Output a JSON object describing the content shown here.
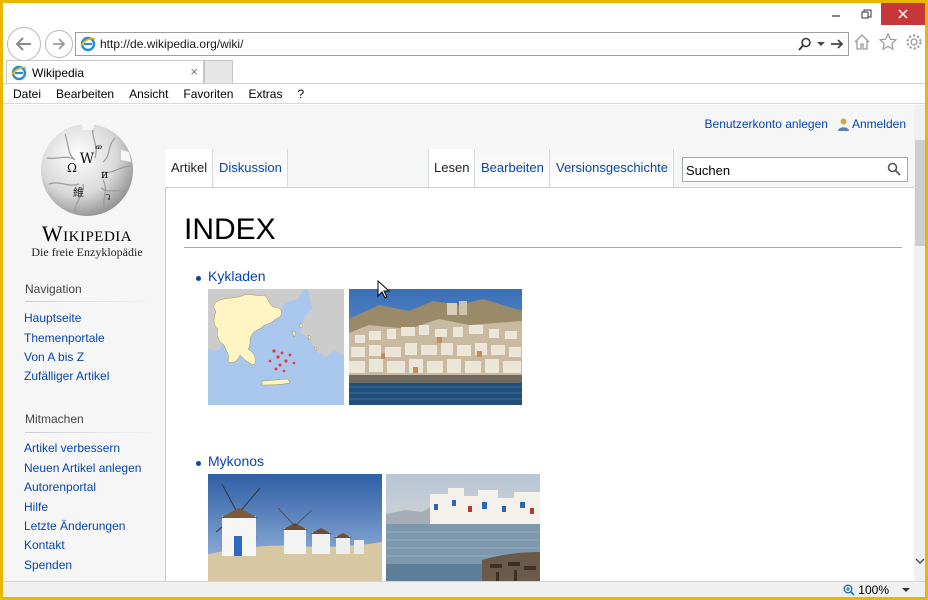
{
  "browser": {
    "url": "http://de.wikipedia.org/wiki/",
    "tab_title": "Wikipedia",
    "tab_close": "×",
    "zoom": "100%"
  },
  "menu": [
    "Datei",
    "Bearbeiten",
    "Ansicht",
    "Favoriten",
    "Extras",
    "?"
  ],
  "wiki": {
    "wordmark": "Wikipedia",
    "tagline": "Die freie Enzyklopädie",
    "personal": {
      "create_account": "Benutzerkonto anlegen",
      "login": "Anmelden"
    },
    "tabs": {
      "article": "Artikel",
      "discussion": "Diskussion",
      "read": "Lesen",
      "edit": "Bearbeiten",
      "history": "Versionsgeschichte"
    },
    "search_placeholder": "Suchen",
    "sidebar": {
      "navigation_heading": "Navigation",
      "navigation": [
        "Hauptseite",
        "Themenportale",
        "Von A bis Z",
        "Zufälliger Artikel"
      ],
      "participate_heading": "Mitmachen",
      "participate": [
        "Artikel verbessern",
        "Neuen Artikel anlegen",
        "Autorenportal",
        "Hilfe",
        "Letzte Änderungen",
        "Kontakt",
        "Spenden"
      ]
    },
    "title": "INDEX",
    "items": [
      {
        "label": "Kykladen"
      },
      {
        "label": "Mykonos"
      }
    ]
  },
  "icons": [
    "back-arrow-icon",
    "forward-arrow-icon",
    "ie-icon",
    "search-icon",
    "refresh-icon",
    "home-icon",
    "favorites-star-icon",
    "gear-icon",
    "user-icon",
    "zoom-icon"
  ],
  "colors": {
    "link": "#0645ad",
    "frame": "#e8b800",
    "close": "#c7373a"
  }
}
